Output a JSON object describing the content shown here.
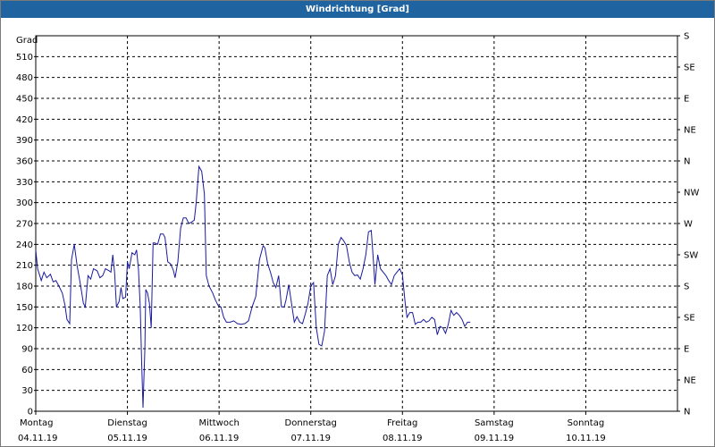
{
  "window": {
    "title": "Windrichtung [Grad]"
  },
  "chart_data": {
    "type": "line",
    "title": "Windrichtung [Grad]",
    "ylabel": "Grad",
    "ylim": [
      0,
      540
    ],
    "xlim": [
      0,
      7
    ],
    "grid": true,
    "line_color": "#1a1aa0",
    "y_ticks": [
      0,
      30,
      60,
      90,
      120,
      150,
      180,
      210,
      240,
      270,
      300,
      330,
      360,
      390,
      420,
      450,
      480,
      510
    ],
    "right_ticks": [
      {
        "value": 0,
        "label": "N"
      },
      {
        "value": 45,
        "label": "NE"
      },
      {
        "value": 90,
        "label": "E"
      },
      {
        "value": 135,
        "label": "SE"
      },
      {
        "value": 180,
        "label": "S"
      },
      {
        "value": 225,
        "label": "SW"
      },
      {
        "value": 270,
        "label": "W"
      },
      {
        "value": 315,
        "label": "NW"
      },
      {
        "value": 360,
        "label": "N"
      },
      {
        "value": 405,
        "label": "NE"
      },
      {
        "value": 450,
        "label": "E"
      },
      {
        "value": 495,
        "label": "SE"
      },
      {
        "value": 540,
        "label": "S"
      }
    ],
    "x_ticks": [
      {
        "day": "Montag",
        "date": "04.11.19"
      },
      {
        "day": "Dienstag",
        "date": "05.11.19"
      },
      {
        "day": "Mittwoch",
        "date": "06.11.19"
      },
      {
        "day": "Donnerstag",
        "date": "07.11.19"
      },
      {
        "day": "Freitag",
        "date": "08.11.19"
      },
      {
        "day": "Samstag",
        "date": "09.11.19"
      },
      {
        "day": "Sonntag",
        "date": "10.11.19"
      }
    ],
    "series": [
      {
        "values": [
          [
            0.0,
            232
          ],
          [
            0.02,
            205
          ],
          [
            0.06,
            188
          ],
          [
            0.09,
            200
          ],
          [
            0.12,
            192
          ],
          [
            0.16,
            197
          ],
          [
            0.19,
            186
          ],
          [
            0.22,
            188
          ],
          [
            0.26,
            178
          ],
          [
            0.29,
            170
          ],
          [
            0.32,
            152
          ],
          [
            0.34,
            132
          ],
          [
            0.37,
            126
          ],
          [
            0.39,
            218
          ],
          [
            0.42,
            240
          ],
          [
            0.45,
            210
          ],
          [
            0.49,
            180
          ],
          [
            0.52,
            155
          ],
          [
            0.54,
            150
          ],
          [
            0.57,
            195
          ],
          [
            0.6,
            190
          ],
          [
            0.63,
            205
          ],
          [
            0.67,
            202
          ],
          [
            0.7,
            192
          ],
          [
            0.73,
            195
          ],
          [
            0.76,
            205
          ],
          [
            0.8,
            202
          ],
          [
            0.82,
            200
          ],
          [
            0.84,
            225
          ],
          [
            0.86,
            200
          ],
          [
            0.88,
            150
          ],
          [
            0.91,
            158
          ],
          [
            0.93,
            178
          ],
          [
            0.95,
            162
          ],
          [
            0.98,
            164
          ],
          [
            1.0,
            215
          ],
          [
            1.02,
            205
          ],
          [
            1.05,
            228
          ],
          [
            1.08,
            225
          ],
          [
            1.1,
            232
          ],
          [
            1.12,
            205
          ],
          [
            1.14,
            150
          ],
          [
            1.155,
            70
          ],
          [
            1.17,
            5
          ],
          [
            1.19,
            90
          ],
          [
            1.2,
            175
          ],
          [
            1.22,
            170
          ],
          [
            1.24,
            155
          ],
          [
            1.26,
            120
          ],
          [
            1.28,
            242
          ],
          [
            1.3,
            242
          ],
          [
            1.33,
            240
          ],
          [
            1.36,
            255
          ],
          [
            1.39,
            255
          ],
          [
            1.41,
            250
          ],
          [
            1.44,
            215
          ],
          [
            1.47,
            212
          ],
          [
            1.5,
            203
          ],
          [
            1.52,
            192
          ],
          [
            1.55,
            215
          ],
          [
            1.58,
            263
          ],
          [
            1.61,
            278
          ],
          [
            1.64,
            278
          ],
          [
            1.67,
            270
          ],
          [
            1.7,
            272
          ],
          [
            1.73,
            275
          ],
          [
            1.75,
            300
          ],
          [
            1.78,
            352
          ],
          [
            1.81,
            345
          ],
          [
            1.84,
            312
          ],
          [
            1.86,
            195
          ],
          [
            1.89,
            180
          ],
          [
            1.93,
            170
          ],
          [
            1.96,
            160
          ],
          [
            1.99,
            152
          ],
          [
            2.02,
            150
          ],
          [
            2.05,
            135
          ],
          [
            2.08,
            128
          ],
          [
            2.12,
            128
          ],
          [
            2.16,
            130
          ],
          [
            2.2,
            126
          ],
          [
            2.24,
            125
          ],
          [
            2.28,
            126
          ],
          [
            2.32,
            130
          ],
          [
            2.36,
            150
          ],
          [
            2.4,
            165
          ],
          [
            2.44,
            218
          ],
          [
            2.48,
            238
          ],
          [
            2.5,
            235
          ],
          [
            2.53,
            212
          ],
          [
            2.56,
            200
          ],
          [
            2.59,
            185
          ],
          [
            2.62,
            178
          ],
          [
            2.65,
            195
          ],
          [
            2.68,
            150
          ],
          [
            2.71,
            150
          ],
          [
            2.73,
            160
          ],
          [
            2.76,
            182
          ],
          [
            2.79,
            155
          ],
          [
            2.82,
            128
          ],
          [
            2.85,
            136
          ],
          [
            2.88,
            128
          ],
          [
            2.91,
            126
          ],
          [
            2.94,
            140
          ],
          [
            2.97,
            155
          ],
          [
            3.0,
            180
          ],
          [
            3.03,
            185
          ],
          [
            3.06,
            120
          ],
          [
            3.09,
            96
          ],
          [
            3.12,
            94
          ],
          [
            3.15,
            115
          ],
          [
            3.18,
            195
          ],
          [
            3.21,
            205
          ],
          [
            3.24,
            182
          ],
          [
            3.27,
            195
          ],
          [
            3.3,
            240
          ],
          [
            3.33,
            250
          ],
          [
            3.36,
            245
          ],
          [
            3.39,
            238
          ],
          [
            3.42,
            215
          ],
          [
            3.45,
            200
          ],
          [
            3.48,
            195
          ],
          [
            3.51,
            196
          ],
          [
            3.54,
            190
          ],
          [
            3.57,
            205
          ],
          [
            3.6,
            225
          ],
          [
            3.63,
            258
          ],
          [
            3.66,
            260
          ],
          [
            3.68,
            222
          ],
          [
            3.7,
            182
          ],
          [
            3.73,
            225
          ],
          [
            3.76,
            205
          ],
          [
            3.79,
            200
          ],
          [
            3.82,
            195
          ],
          [
            3.85,
            188
          ],
          [
            3.88,
            182
          ],
          [
            3.91,
            195
          ],
          [
            3.94,
            200
          ],
          [
            3.97,
            205
          ],
          [
            4.0,
            196
          ],
          [
            4.03,
            155
          ],
          [
            4.05,
            135
          ],
          [
            4.08,
            142
          ],
          [
            4.11,
            142
          ],
          [
            4.14,
            125
          ],
          [
            4.17,
            128
          ],
          [
            4.2,
            128
          ],
          [
            4.23,
            132
          ],
          [
            4.26,
            128
          ],
          [
            4.29,
            130
          ],
          [
            4.32,
            135
          ],
          [
            4.35,
            132
          ],
          [
            4.38,
            110
          ],
          [
            4.41,
            122
          ],
          [
            4.44,
            120
          ],
          [
            4.47,
            112
          ],
          [
            4.5,
            125
          ],
          [
            4.53,
            145
          ],
          [
            4.56,
            138
          ],
          [
            4.59,
            142
          ],
          [
            4.62,
            138
          ],
          [
            4.65,
            132
          ],
          [
            4.68,
            122
          ],
          [
            4.71,
            128
          ],
          [
            4.74,
            128
          ]
        ]
      }
    ]
  }
}
